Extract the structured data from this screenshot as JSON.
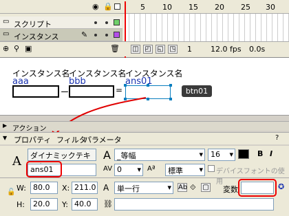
{
  "timeline": {
    "frame_numbers": [
      "5",
      "10",
      "15",
      "20",
      "25",
      "30",
      "35"
    ],
    "layers": [
      {
        "name": "スクリプト",
        "color": "#6fd06a"
      },
      {
        "name": "インスタンス",
        "color": "#b44ee8"
      }
    ],
    "status": {
      "frame": "1",
      "fps": "12.0 fps",
      "time": "0.0s"
    }
  },
  "stage": {
    "labels": [
      "インスタンス名",
      "インスタンス名",
      "インスタンス名"
    ],
    "instances": [
      "aaa",
      "bbb",
      "ans01"
    ],
    "operators": [
      "ー",
      "="
    ],
    "button": "btn01"
  },
  "panels": {
    "action": "アクション",
    "tabs": [
      "プロパティ",
      "フィルタ",
      "パラメータ"
    ]
  },
  "properties": {
    "text_type": "ダイナミックテキスト",
    "instance_name": "ans01",
    "font": "_等幅",
    "font_size": "16",
    "letter_spacing": "0",
    "char_option": "標準",
    "device_font": "デバイスフォントの使用",
    "line_type": "単一行",
    "variable_label": "変数",
    "variable_value": "",
    "w_label": "W:",
    "w_value": "80.0",
    "x_label": "X:",
    "x_value": "211.0",
    "h_label": "H:",
    "h_value": "20.0",
    "y_label": "Y:",
    "y_value": "40.0",
    "bold": "B",
    "italic": "I",
    "text_glyph": "A"
  },
  "colors": {
    "annotation": "#e00000",
    "accent": "#1a33b0"
  }
}
